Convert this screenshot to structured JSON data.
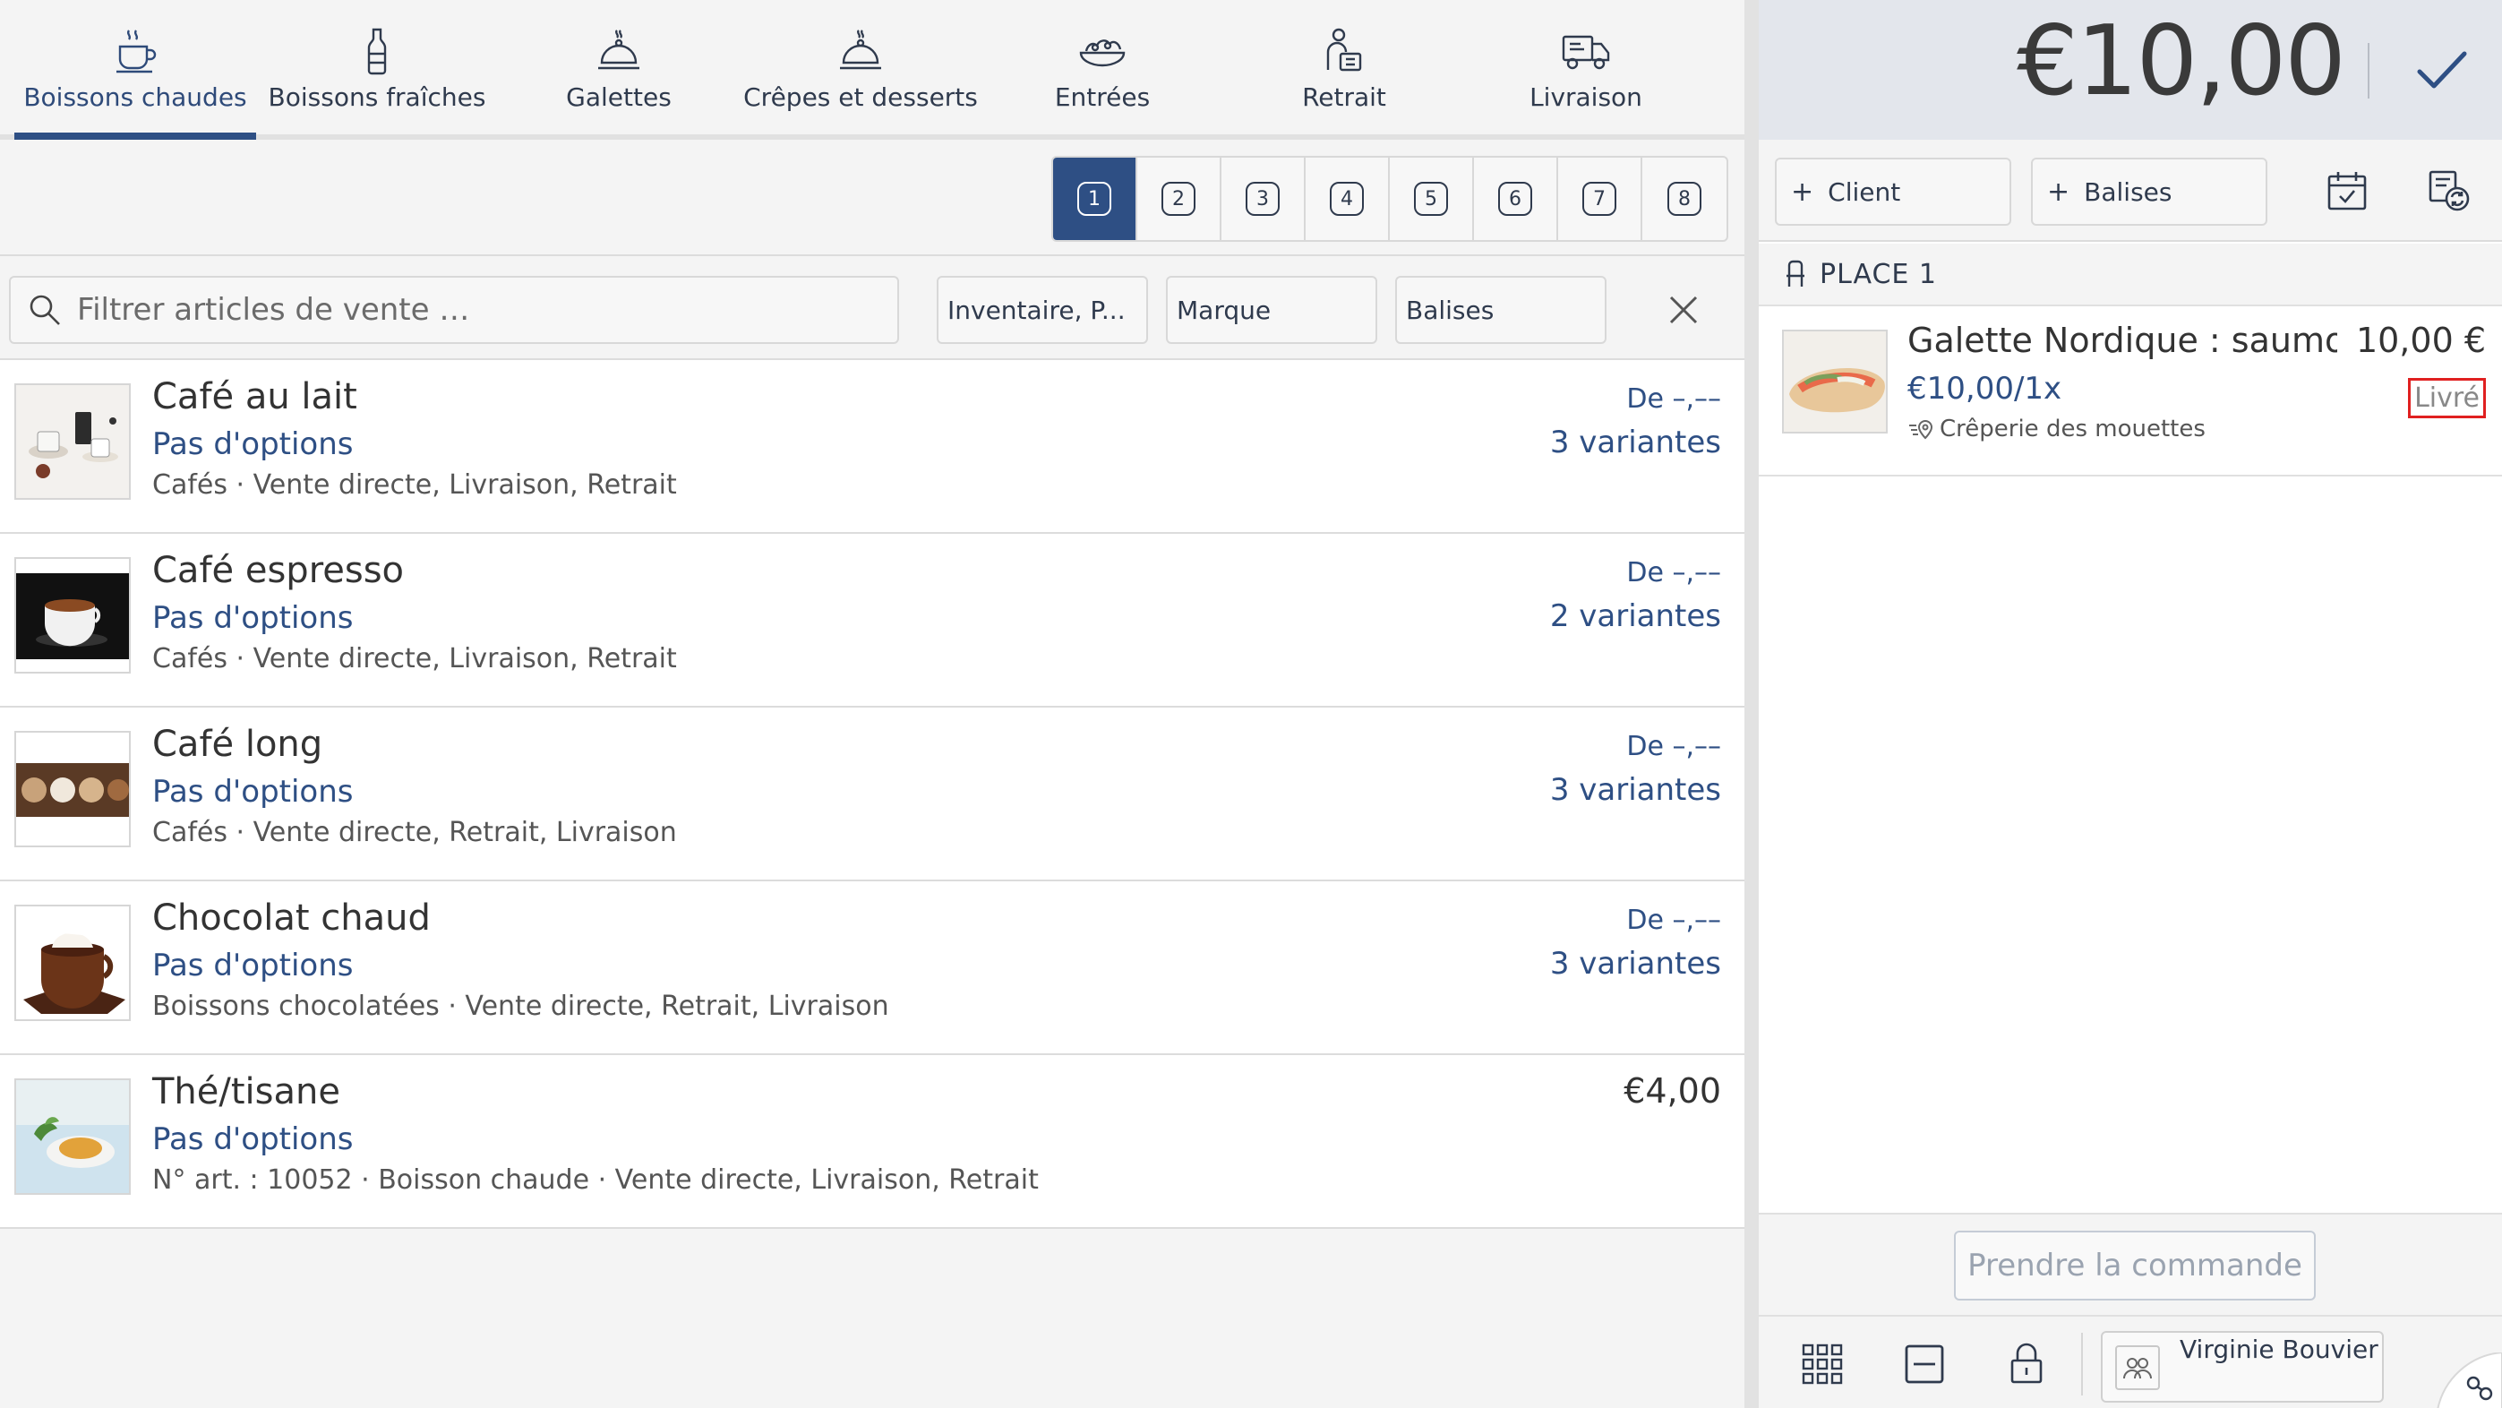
{
  "categories": [
    {
      "label": "Boissons chaudes",
      "icon": "hot-drink-icon",
      "active": true
    },
    {
      "label": "Boissons fraîches",
      "icon": "bottle-icon"
    },
    {
      "label": "Galettes",
      "icon": "cloche-icon"
    },
    {
      "label": "Crêpes et desserts",
      "icon": "cloche-icon"
    },
    {
      "label": "Entrées",
      "icon": "salad-icon"
    },
    {
      "label": "Retrait",
      "icon": "pickup-icon"
    },
    {
      "label": "Livraison",
      "icon": "delivery-truck-icon"
    }
  ],
  "places": {
    "items": [
      "1",
      "2",
      "3",
      "4",
      "5",
      "6",
      "7",
      "8"
    ],
    "active": "1"
  },
  "filter": {
    "search_placeholder": "Filtrer articles de vente …",
    "chip_inventory": "Inventaire, P...",
    "chip_brand": "Marque",
    "chip_tags": "Balises"
  },
  "items": [
    {
      "name": "Café au lait",
      "options": "Pas d'options",
      "meta": "Cafés · Vente directe, Livraison, Retrait",
      "price_from": "De –,––",
      "variants": "3 variantes"
    },
    {
      "name": "Café espresso",
      "options": "Pas d'options",
      "meta": "Cafés · Vente directe, Livraison, Retrait",
      "price_from": "De –,––",
      "variants": "2 variantes"
    },
    {
      "name": "Café long",
      "options": "Pas d'options",
      "meta": "Cafés · Vente directe, Retrait, Livraison",
      "price_from": "De –,––",
      "variants": "3 variantes"
    },
    {
      "name": "Chocolat chaud",
      "options": "Pas d'options",
      "meta": "Boissons chocolatées · Vente directe, Retrait, Livraison",
      "price_from": "De –,––",
      "variants": "3 variantes"
    },
    {
      "name": "Thé/tisane",
      "options": "Pas d'options",
      "meta": "N° art. : 10052 · Boisson chaude · Vente directe, Livraison, Retrait",
      "price": "€4,00"
    }
  ],
  "order": {
    "total": "€10,00",
    "client_label": "Client",
    "tags_label": "Balises",
    "place_title": "PLACE 1",
    "line": {
      "name": "Galette Nordique : saumo...",
      "price": "10,00 €",
      "unit": "€10,00/1x",
      "status": "Livré",
      "vendor": "Crêperie des mouettes"
    },
    "take_order_label": "Prendre la commande",
    "user_name": "Virginie Bouvier"
  },
  "colors": {
    "accent": "#2e4f84",
    "status_border": "#e02020"
  }
}
